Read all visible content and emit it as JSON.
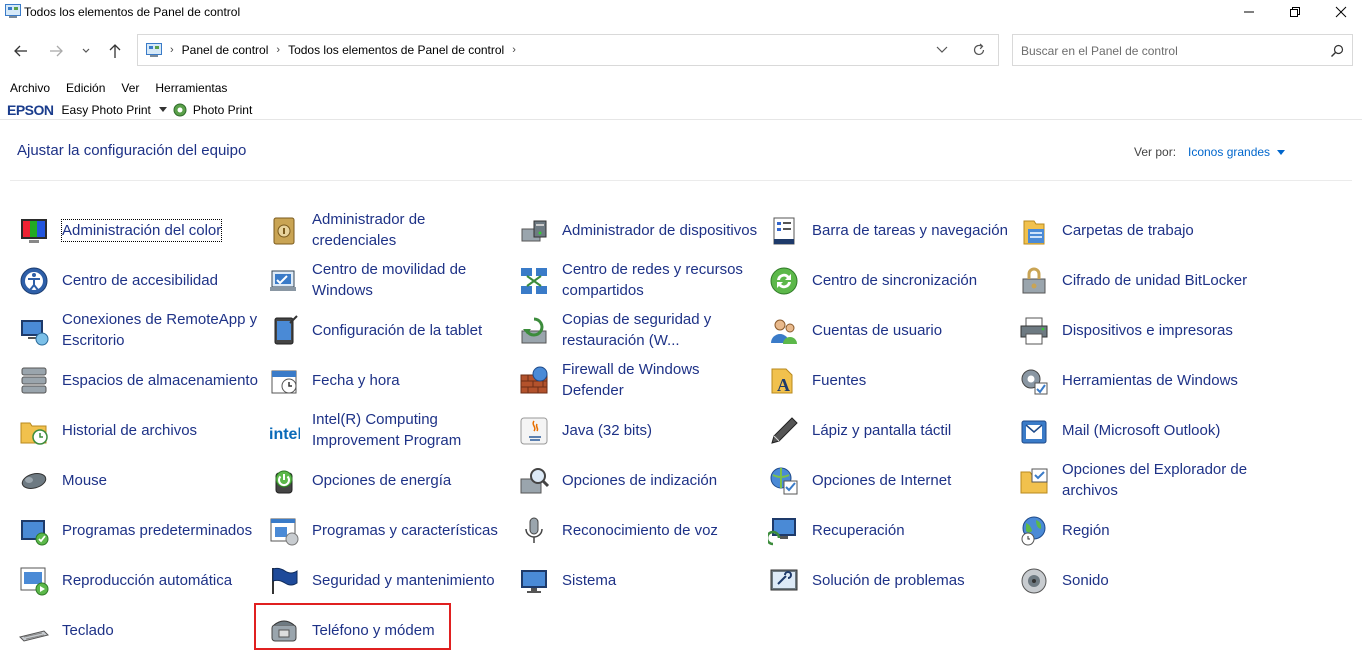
{
  "window": {
    "title": "Todos los elementos de Panel de control"
  },
  "address_bar": {
    "breadcrumbs": [
      "Panel de control",
      "Todos los elementos de Panel de control"
    ]
  },
  "search": {
    "placeholder": "Buscar en el Panel de control"
  },
  "menu": [
    "Archivo",
    "Edición",
    "Ver",
    "Herramientas"
  ],
  "epson_toolbar": {
    "brand": "EPSON",
    "easy_photo_print": "Easy Photo Print",
    "photo_print": "Photo Print"
  },
  "header": {
    "title": "Ajustar la configuración del equipo",
    "view_by_label": "Ver por:",
    "view_by_value": "Iconos grandes"
  },
  "items": [
    {
      "label": "Administración del color",
      "icon": "color-management-icon"
    },
    {
      "label": "Administrador de credenciales",
      "icon": "credential-manager-icon"
    },
    {
      "label": "Administrador de dispositivos",
      "icon": "device-manager-icon"
    },
    {
      "label": "Barra de tareas y navegación",
      "icon": "taskbar-icon"
    },
    {
      "label": "Carpetas de trabajo",
      "icon": "work-folders-icon"
    },
    {
      "label": "Centro de accesibilidad",
      "icon": "accessibility-icon"
    },
    {
      "label": "Centro de movilidad de Windows",
      "icon": "mobility-center-icon"
    },
    {
      "label": "Centro de redes y recursos compartidos",
      "icon": "network-icon"
    },
    {
      "label": "Centro de sincronización",
      "icon": "sync-center-icon"
    },
    {
      "label": "Cifrado de unidad BitLocker",
      "icon": "bitlocker-icon"
    },
    {
      "label": "Conexiones de RemoteApp y Escritorio",
      "icon": "remoteapp-icon"
    },
    {
      "label": "Configuración de la tablet",
      "icon": "tablet-icon"
    },
    {
      "label": "Copias de seguridad y restauración (W...",
      "icon": "backup-icon"
    },
    {
      "label": "Cuentas de usuario",
      "icon": "user-accounts-icon"
    },
    {
      "label": "Dispositivos e impresoras",
      "icon": "printer-icon"
    },
    {
      "label": "Espacios de almacenamiento",
      "icon": "storage-spaces-icon"
    },
    {
      "label": "Fecha y hora",
      "icon": "date-time-icon"
    },
    {
      "label": "Firewall de Windows Defender",
      "icon": "firewall-icon"
    },
    {
      "label": "Fuentes",
      "icon": "fonts-icon"
    },
    {
      "label": "Herramientas de Windows",
      "icon": "windows-tools-icon"
    },
    {
      "label": "Historial de archivos",
      "icon": "file-history-icon"
    },
    {
      "label": "Intel(R) Computing Improvement Program",
      "icon": "intel-icon"
    },
    {
      "label": "Java (32 bits)",
      "icon": "java-icon"
    },
    {
      "label": "Lápiz y pantalla táctil",
      "icon": "pen-icon"
    },
    {
      "label": "Mail (Microsoft Outlook)",
      "icon": "mail-icon"
    },
    {
      "label": "Mouse",
      "icon": "mouse-icon"
    },
    {
      "label": "Opciones de energía",
      "icon": "power-options-icon"
    },
    {
      "label": "Opciones de indización",
      "icon": "indexing-icon"
    },
    {
      "label": "Opciones de Internet",
      "icon": "internet-options-icon"
    },
    {
      "label": "Opciones del Explorador de archivos",
      "icon": "explorer-options-icon"
    },
    {
      "label": "Programas predeterminados",
      "icon": "default-programs-icon"
    },
    {
      "label": "Programas y características",
      "icon": "programs-features-icon"
    },
    {
      "label": "Reconocimiento de voz",
      "icon": "microphone-icon"
    },
    {
      "label": "Recuperación",
      "icon": "recovery-icon"
    },
    {
      "label": "Región",
      "icon": "region-icon"
    },
    {
      "label": "Reproducción automática",
      "icon": "autoplay-icon"
    },
    {
      "label": "Seguridad y mantenimiento",
      "icon": "flag-icon"
    },
    {
      "label": "Sistema",
      "icon": "system-icon"
    },
    {
      "label": "Solución de problemas",
      "icon": "troubleshooting-icon"
    },
    {
      "label": "Sonido",
      "icon": "sound-icon"
    },
    {
      "label": "Teclado",
      "icon": "keyboard-icon"
    },
    {
      "label": "Teléfono y módem",
      "icon": "phone-modem-icon"
    }
  ]
}
